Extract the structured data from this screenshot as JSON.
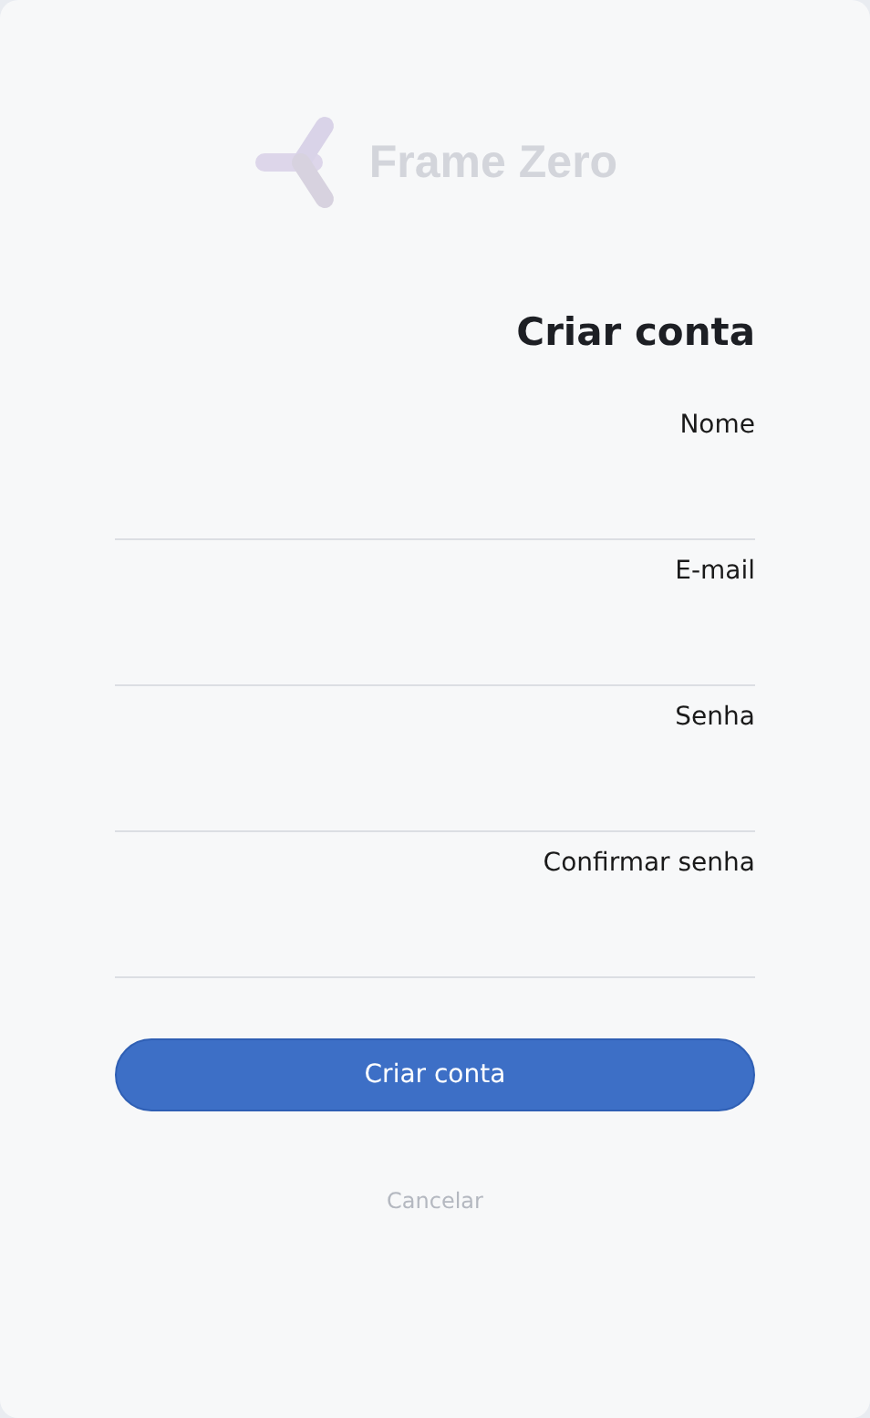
{
  "brand": {
    "name": "Frame Zero"
  },
  "title": "Criar conta",
  "fields": [
    {
      "label": "Nome"
    },
    {
      "label": "E-mail"
    },
    {
      "label": "Senha"
    },
    {
      "label": "Confirmar senha"
    }
  ],
  "primary_button": "Criar conta",
  "cancel_link": "Cancelar"
}
